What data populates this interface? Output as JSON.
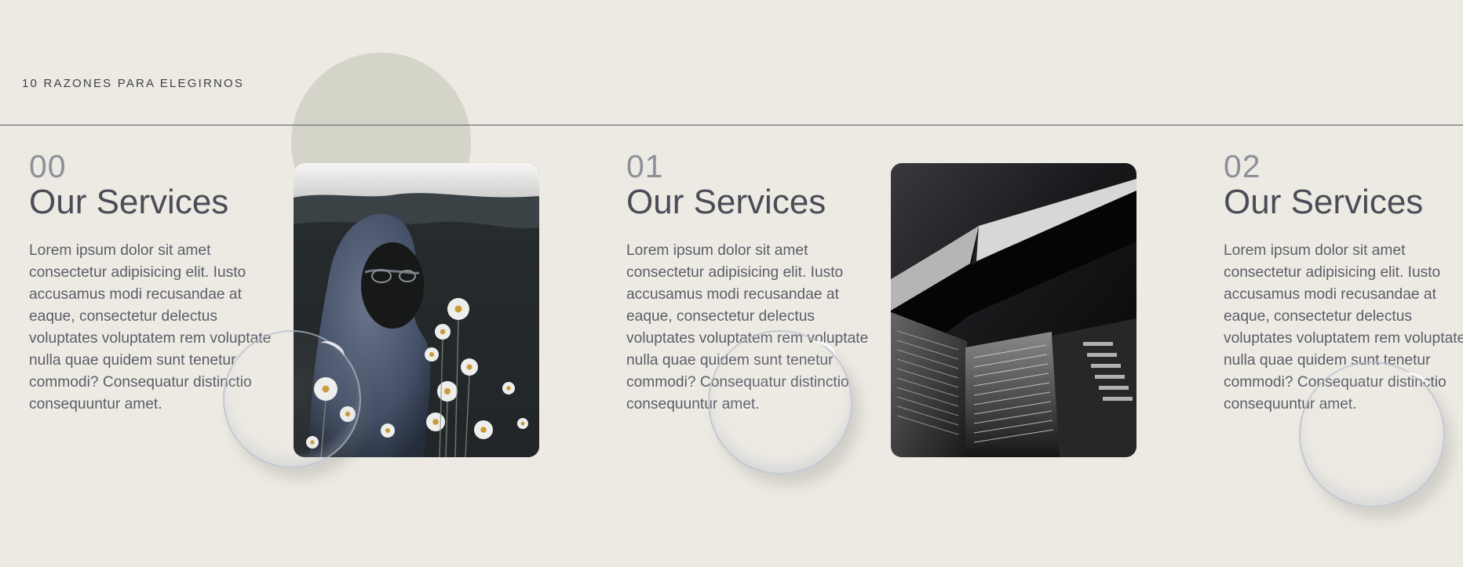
{
  "section": {
    "eyebrow": "10 RAZONES PARA ELEGIRNOS"
  },
  "cards": [
    {
      "number": "00",
      "title": "Our Services",
      "body": "Lorem ipsum dolor sit amet consectetur adipisicing elit. Iusto accusamus modi recusandae at eaque, consectetur delectus voluptates voluptatem rem voluptate nulla quae quidem sunt tenetur commodi? Consequatur distinctio consequuntur amet."
    },
    {
      "number": "01",
      "title": "Our Services",
      "body": "Lorem ipsum dolor sit amet consectetur adipisicing elit. Iusto accusamus modi recusandae at eaque, consectetur delectus voluptates voluptatem rem voluptate nulla quae quidem sunt tenetur commodi? Consequatur distinctio consequuntur amet."
    },
    {
      "number": "02",
      "title": "Our Services",
      "body": "Lorem ipsum dolor sit amet consectetur adipisicing elit. Iusto accusamus modi recusandae at eaque, consectetur delectus voluptates voluptatem rem voluptate nulla quae quidem sunt tenetur commodi? Consequatur distinctio consequuntur amet."
    }
  ],
  "images": [
    {
      "name": "hooded-person-in-daisy-field-photo"
    },
    {
      "name": "black-and-white-architecture-photo"
    }
  ],
  "colors": {
    "background": "#edeae3",
    "decorative_circle": "#d4d5c8",
    "text": "#4a4d57",
    "muted_text": "#8d909a",
    "divider": "#5b5f68"
  }
}
